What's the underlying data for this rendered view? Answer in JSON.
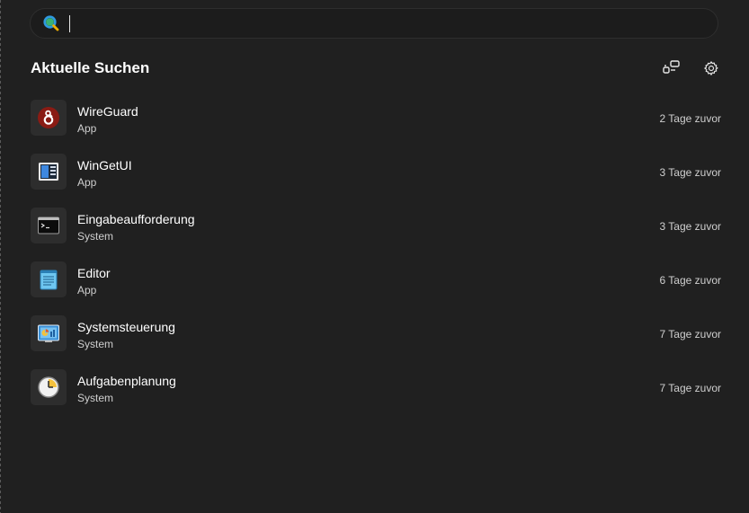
{
  "search": {
    "value": "",
    "placeholder": ""
  },
  "section": {
    "title": "Aktuelle Suchen"
  },
  "header_actions": [
    {
      "icon": "app-list-icon"
    },
    {
      "icon": "gear-icon"
    }
  ],
  "items": [
    {
      "title": "WireGuard",
      "subtitle": "App",
      "time": "2 Tage zuvor",
      "icon": "wireguard-icon"
    },
    {
      "title": "WinGetUI",
      "subtitle": "App",
      "time": "3 Tage zuvor",
      "icon": "wingetui-icon"
    },
    {
      "title": "Eingabeaufforderung",
      "subtitle": "System",
      "time": "3 Tage zuvor",
      "icon": "command-prompt-icon"
    },
    {
      "title": "Editor",
      "subtitle": "App",
      "time": "6 Tage zuvor",
      "icon": "notepad-icon"
    },
    {
      "title": "Systemsteuerung",
      "subtitle": "System",
      "time": "7 Tage zuvor",
      "icon": "control-panel-icon"
    },
    {
      "title": "Aufgabenplanung",
      "subtitle": "System",
      "time": "7 Tage zuvor",
      "icon": "task-scheduler-icon"
    }
  ],
  "colors": {
    "background": "#202020",
    "tile": "#2d2d2d",
    "text": "#ffffff",
    "muted": "#cfcfcf"
  }
}
